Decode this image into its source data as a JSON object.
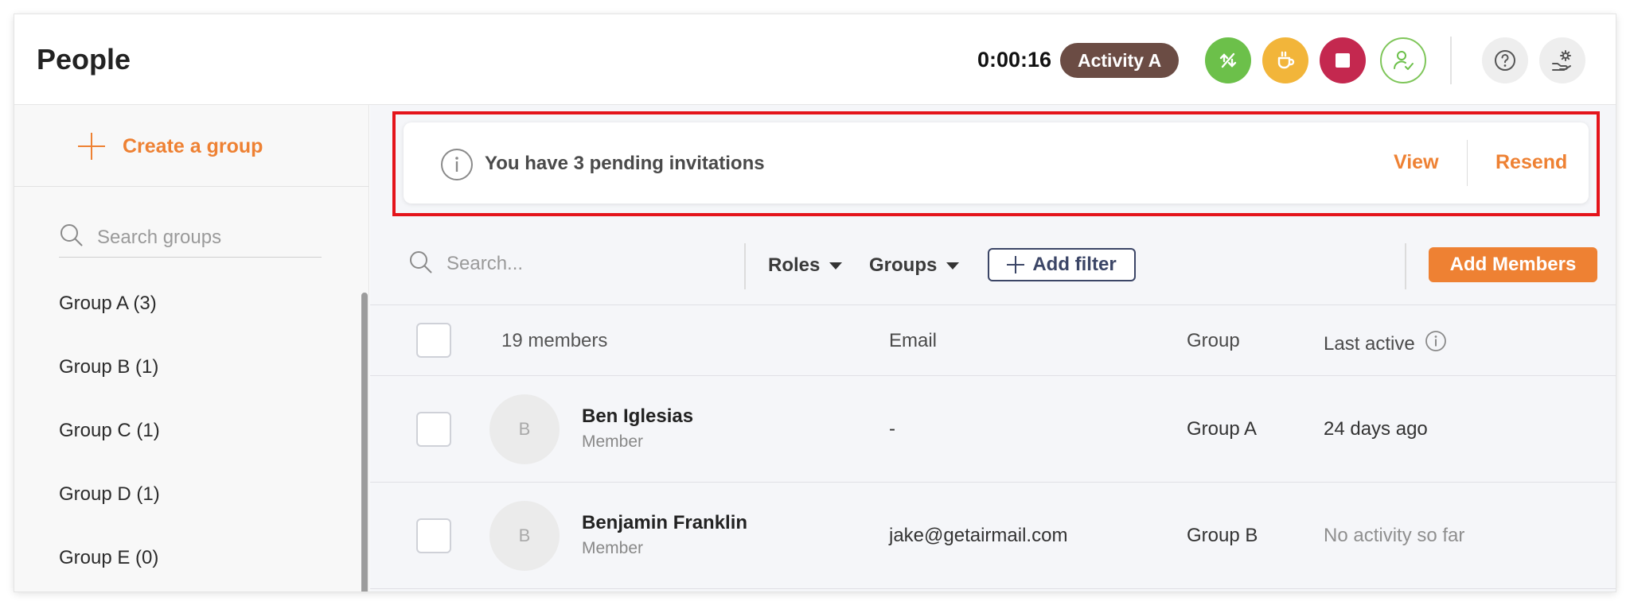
{
  "header": {
    "title": "People",
    "timer": "0:00:16",
    "activity": "Activity A",
    "icons": [
      "route-icon",
      "coffee-icon",
      "stop-icon",
      "user-check-icon",
      "help-icon",
      "settings-icon"
    ],
    "colors": {
      "green": "#6cc04a",
      "yellow": "#f2b53a",
      "red": "#c4284f",
      "activity": "#6b4c44"
    }
  },
  "sidebar": {
    "create_group": "Create a group",
    "search_placeholder": "Search groups",
    "groups": [
      {
        "label": "Group A (3)"
      },
      {
        "label": "Group B (1)"
      },
      {
        "label": "Group C (1)"
      },
      {
        "label": "Group D (1)"
      },
      {
        "label": "Group E (0)"
      }
    ]
  },
  "banner": {
    "text": "You have 3 pending invitations",
    "view": "View",
    "resend": "Resend"
  },
  "toolbar": {
    "search_placeholder": "Search...",
    "roles": "Roles",
    "groups": "Groups",
    "add_filter": "Add filter",
    "add_members": "Add Members",
    "accent": "#ee8133"
  },
  "table": {
    "columns": {
      "members": "19 members",
      "email": "Email",
      "group": "Group",
      "last_active": "Last active"
    },
    "rows": [
      {
        "initial": "B",
        "name": "Ben Iglesias",
        "role": "Member",
        "email": "-",
        "group": "Group A",
        "last_active": "24 days ago"
      },
      {
        "initial": "B",
        "name": "Benjamin Franklin",
        "role": "Member",
        "email": "jake@getairmail.com",
        "group": "Group B",
        "last_active": "No activity so far"
      }
    ]
  }
}
